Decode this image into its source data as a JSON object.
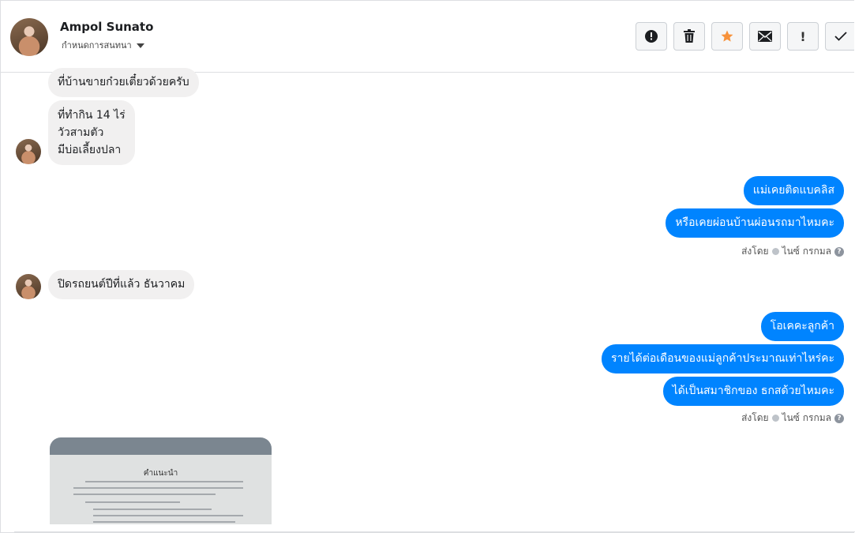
{
  "header": {
    "name": "Ampol Sunato",
    "subtitle": "กำหนดการสนทนา",
    "toolbar": {
      "spam_icon": "exclamation-circle-icon",
      "delete_icon": "trash-icon",
      "star_icon": "star-icon",
      "star_color": "#f7923b",
      "mail_icon": "envelope-icon",
      "important_glyph": "!",
      "done_icon": "check-icon"
    }
  },
  "messages": {
    "m1": "ที่บ้านขายก๋วยเตี๋ยวด้วยครับ",
    "m2_lines": [
      "ที่ทำกิน 14 ไร่",
      "วัวสามตัว",
      "มีบ่อเลี้ยงปลา"
    ],
    "m3": "แม่เคยติดแบคลิส",
    "m4": "หรือเคยผ่อนบ้านผ่อนรถมาไหมคะ",
    "sent1": {
      "prefix": "ส่งโดย",
      "name": "ไนซ์ กรกมล",
      "help": "?"
    },
    "m5": "ปิดรถยนต์ปีที่แล้ว ธันวาคม",
    "m6": "โอเคคะลูกค้า",
    "m7": "รายได้ต่อเดือนของแม่ลูกค้าประมาณเท่าไหร่คะ",
    "m8": "ได้เป็นสมาชิกของ ธกสด้วยไหมคะ",
    "sent2": {
      "prefix": "ส่งโดย",
      "name": "ไนซ์ กรกมล",
      "help": "?"
    },
    "photo_title": "คำแนะนำ"
  },
  "colors": {
    "outgoing_bubble": "#0084ff",
    "incoming_bubble": "#f1f0f0"
  }
}
